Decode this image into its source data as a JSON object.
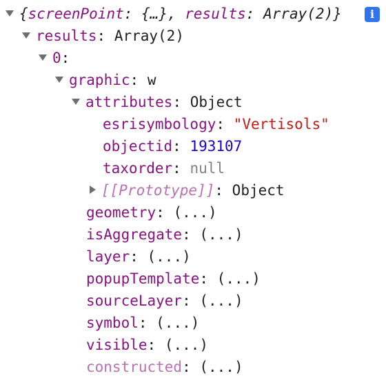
{
  "summary": {
    "open": "{",
    "key1": "screenPoint",
    "sep1": ": ",
    "val1": "{…}",
    "comma": ", ",
    "key2": "results",
    "sep2": ": ",
    "val2": "Array(2)",
    "close": "}",
    "info_badge": "i"
  },
  "tree": {
    "results": {
      "key": "results",
      "sep": ": ",
      "value": "Array(2)"
    },
    "item0": {
      "key": "0",
      "sep": ":"
    },
    "graphic": {
      "key": "graphic",
      "sep": ": ",
      "value": "w"
    },
    "attributes": {
      "key": "attributes",
      "sep": ": ",
      "value": "Object"
    },
    "esrisymbology": {
      "key": "esrisymbology",
      "sep": ": ",
      "value": "\"Vertisols\""
    },
    "objectid": {
      "key": "objectid",
      "sep": ": ",
      "value": "193107"
    },
    "taxorder": {
      "key": "taxorder",
      "sep": ": ",
      "value": "null"
    },
    "prototype": {
      "key": "[[Prototype]]",
      "sep": ": ",
      "value": "Object"
    },
    "geometry": {
      "key": "geometry",
      "sep": ": ",
      "value": "(...)"
    },
    "isAggregate": {
      "key": "isAggregate",
      "sep": ": ",
      "value": "(...)"
    },
    "layer": {
      "key": "layer",
      "sep": ": ",
      "value": "(...)"
    },
    "popupTemplate": {
      "key": "popupTemplate",
      "sep": ": ",
      "value": "(...)"
    },
    "sourceLayer": {
      "key": "sourceLayer",
      "sep": ": ",
      "value": "(...)"
    },
    "symbol": {
      "key": "symbol",
      "sep": ": ",
      "value": "(...)"
    },
    "visible": {
      "key": "visible",
      "sep": ": ",
      "value": "(...)"
    },
    "constructed": {
      "key": "constructed",
      "sep": ": ",
      "value": "(...)"
    }
  },
  "icons": {
    "expanded": "triangle-down-icon",
    "collapsed": "triangle-right-icon",
    "info": "info-icon"
  },
  "colors": {
    "key": "#881280",
    "key_dim": "#b871b3",
    "string": "#c41a16",
    "number": "#1c00cf",
    "null": "#808080",
    "text": "#1f1f1f",
    "triangle": "#6e6e6e",
    "info_badge_bg": "#2f74ea"
  }
}
